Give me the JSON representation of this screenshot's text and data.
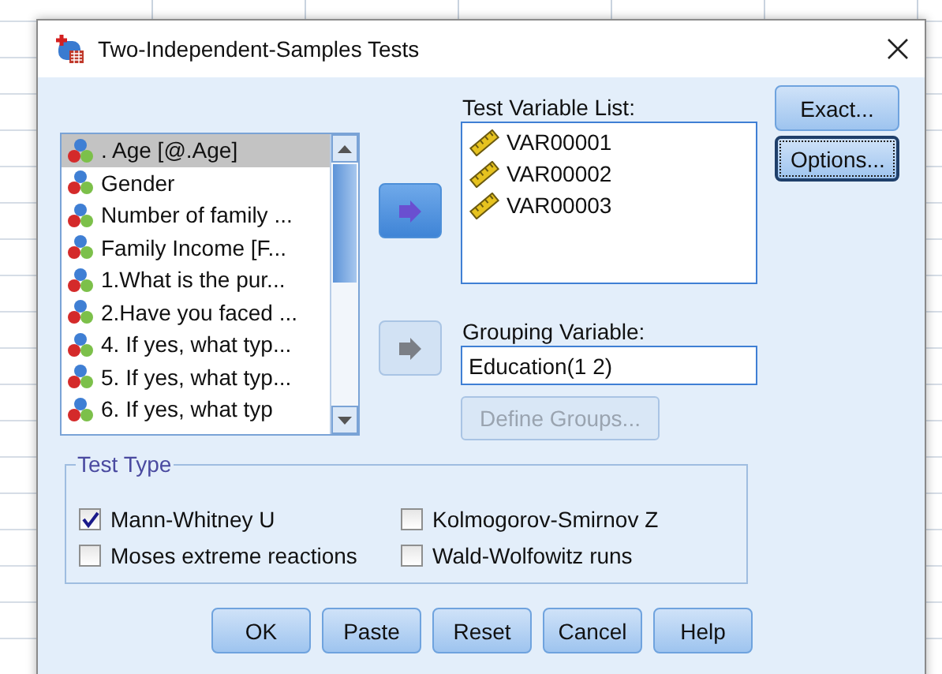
{
  "window": {
    "title": "Two-Independent-Samples Tests"
  },
  "source_list": {
    "items": [
      {
        "label": ". Age [@.Age]",
        "selected": true
      },
      {
        "label": "Gender",
        "selected": false
      },
      {
        "label": "Number of family ...",
        "selected": false
      },
      {
        "label": "Family Income [F...",
        "selected": false
      },
      {
        "label": "1.What is the pur...",
        "selected": false
      },
      {
        "label": "2.Have you faced ...",
        "selected": false
      },
      {
        "label": "4. If yes, what typ...",
        "selected": false
      },
      {
        "label": "5. If yes, what typ...",
        "selected": false
      },
      {
        "label": "6. If yes, what typ",
        "selected": false
      }
    ]
  },
  "move_buttons": [
    {
      "disabled": false
    },
    {
      "disabled": true
    }
  ],
  "test_variables": {
    "label": "Test Variable List:",
    "items": [
      "VAR00001",
      "VAR00002",
      "VAR00003"
    ]
  },
  "grouping": {
    "label": "Grouping Variable:",
    "value": "Education(1 2)",
    "define_button": {
      "label": "Define Groups...",
      "disabled": true
    }
  },
  "side_buttons": [
    {
      "label": "Exact...",
      "focused": false
    },
    {
      "label": "Options...",
      "focused": true
    }
  ],
  "test_type": {
    "title": "Test Type",
    "options": [
      {
        "label": "Mann-Whitney U",
        "checked": true
      },
      {
        "label": "Kolmogorov-Smirnov Z",
        "checked": false
      },
      {
        "label": "Moses extreme reactions",
        "checked": false
      },
      {
        "label": "Wald-Wolfowitz runs",
        "checked": false
      }
    ]
  },
  "buttons": [
    "OK",
    "Paste",
    "Reset",
    "Cancel",
    "Help"
  ]
}
